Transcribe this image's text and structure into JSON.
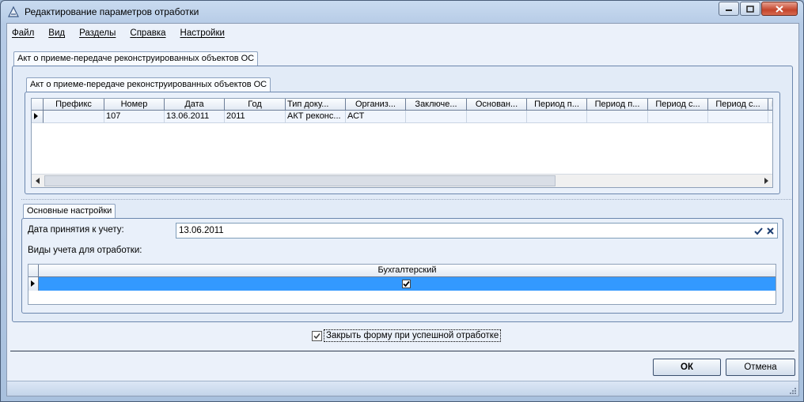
{
  "window": {
    "title": "Редактирование параметров отработки"
  },
  "menu": {
    "items": [
      {
        "first": "Ф",
        "rest": "айл"
      },
      {
        "first": "В",
        "rest": "ид"
      },
      {
        "first": "Р",
        "rest": "азделы"
      },
      {
        "first": "С",
        "rest": "правка"
      },
      {
        "first": "Н",
        "rest": "астройки"
      }
    ]
  },
  "outer_tab": {
    "label": "Акт о приеме-передаче реконструированных объектов ОС"
  },
  "inner_tab": {
    "label": "Акт о приеме-передаче реконструированных объектов ОС"
  },
  "grid": {
    "columns": [
      "Префикс",
      "Номер",
      "Дата",
      "Год",
      "Тип доку...",
      "Организ...",
      "Заключе...",
      "Основан...",
      "Период п...",
      "Период п...",
      "Период с...",
      "Период с...",
      "П"
    ],
    "rows": [
      [
        "",
        "107",
        "13.06.2011",
        "2011",
        "АКТ реконс...",
        "АСТ",
        "",
        "",
        "",
        "",
        "",
        "",
        ""
      ]
    ]
  },
  "settings_tab": {
    "label": "Основные настройки"
  },
  "date_field": {
    "label": "Дата принятия к учету:",
    "value": "13.06.2011"
  },
  "accounting": {
    "label": "Виды учета для отработки:",
    "column": "Бухгалтерский",
    "checked": true
  },
  "close_form": {
    "label": "Закрыть форму при успешной отработке",
    "checked": true
  },
  "buttons": {
    "ok": "ОК",
    "cancel": "Отмена"
  },
  "colors": {
    "selection": "#3399ff",
    "window_frame": "#b6cbe6"
  }
}
